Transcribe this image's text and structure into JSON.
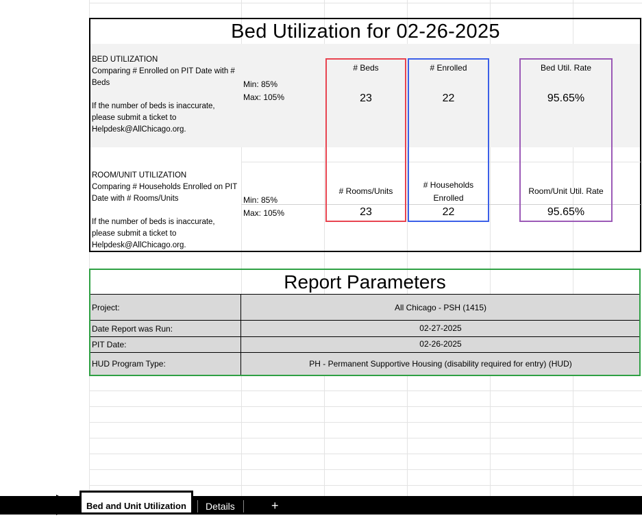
{
  "bed_section": {
    "title": "Bed Utilization for 02-26-2025",
    "heading": "BED UTILIZATION",
    "desc": "Comparing # Enrolled on PIT Date with # Beds",
    "note_line1": "If the number of beds is inaccurate,",
    "note_line2": "please submit a ticket to",
    "note_line3": "Helpdesk@AllChicago.org.",
    "min": "Min: 85%",
    "max": "Max: 105%",
    "beds_label": "# Beds",
    "beds_value": "23",
    "enrolled_label": "# Enrolled",
    "enrolled_value": "22",
    "rate_label": "Bed Util. Rate",
    "rate_value": "95.65%"
  },
  "unit_section": {
    "heading": "ROOM/UNIT UTILIZATION",
    "desc": "Comparing # Households Enrolled on PIT Date with # Rooms/Units",
    "note_line1": "If the number of beds is inaccurate,",
    "note_line2": "please submit a ticket to",
    "note_line3": "Helpdesk@AllChicago.org.",
    "min": "Min: 85%",
    "max": "Max: 105%",
    "rooms_label": "# Rooms/Units",
    "rooms_value": "23",
    "households_label_1": "# Households",
    "households_label_2": "Enrolled",
    "households_value": "22",
    "rate_label": "Room/Unit Util. Rate",
    "rate_value": "95.65%"
  },
  "report_parameters": {
    "title": "Report Parameters",
    "rows": [
      {
        "key": "Project:",
        "value": "All Chicago - PSH (1415)"
      },
      {
        "key": "Date Report was Run:",
        "value": "02-27-2025"
      },
      {
        "key": "PIT Date:",
        "value": "02-26-2025"
      },
      {
        "key": "HUD Program Type:",
        "value": "PH - Permanent Supportive Housing (disability required for entry) (HUD)"
      }
    ]
  },
  "sheet_tabs": {
    "active": "Bed and Unit Utilization",
    "other": "Details",
    "add": "+"
  },
  "colors": {
    "beds_box": "#e8434f",
    "enrolled_box": "#3b5fe8",
    "rate_box": "#9b59b6",
    "params_box": "#2ea043"
  }
}
